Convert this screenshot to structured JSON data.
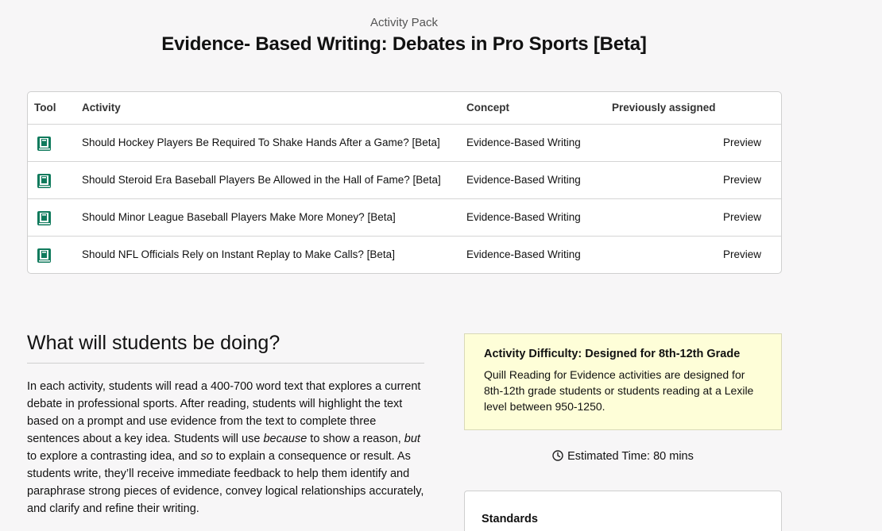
{
  "header": {
    "subtitle": "Activity Pack",
    "title": "Evidence- Based Writing: Debates in Pro Sports [Beta]"
  },
  "table": {
    "columns": {
      "tool": "Tool",
      "activity": "Activity",
      "concept": "Concept",
      "previously_assigned": "Previously assigned"
    },
    "rows": [
      {
        "tool_icon": "book-icon",
        "activity": "Should Hockey Players Be Required To Shake Hands After a Game? [Beta]",
        "concept": "Evidence-Based Writing",
        "preview": "Preview"
      },
      {
        "tool_icon": "book-icon",
        "activity": "Should Steroid Era Baseball Players Be Allowed in the Hall of Fame? [Beta]",
        "concept": "Evidence-Based Writing",
        "preview": "Preview"
      },
      {
        "tool_icon": "book-icon",
        "activity": "Should Minor League Baseball Players Make More Money? [Beta]",
        "concept": "Evidence-Based Writing",
        "preview": "Preview"
      },
      {
        "tool_icon": "book-icon",
        "activity": "Should NFL Officials Rely on Instant Replay to Make Calls? [Beta]",
        "concept": "Evidence-Based Writing",
        "preview": "Preview"
      }
    ]
  },
  "details": {
    "heading": "What will students be doing?",
    "desc_part1": "In each activity, students will read a 400-700 word text that explores a current debate in professional sports. After reading, students will highlight the text based on a prompt and use evidence from the text to complete three sentences about a key idea. Students will use ",
    "desc_because": "because",
    "desc_part2": " to show a reason, ",
    "desc_but": "but",
    "desc_part3": " to explore a contrasting idea, and ",
    "desc_so": "so",
    "desc_part4": " to explain a consequence or result. As students write, they’ll receive immediate feedback to help them identify and paraphrase strong pieces of evidence, convey logical relationships accurately, and clarify and refine their writing."
  },
  "difficulty": {
    "title": "Activity Difficulty: Designed for 8th-12th Grade",
    "body": "Quill Reading for Evidence activities are designed for 8th-12th grade students or students reading at a Lexile level between 950-1250."
  },
  "estimated_time": "Estimated Time: 80 mins",
  "standards": {
    "title": "Standards"
  },
  "colors": {
    "accent_icon": "#0f7a5c",
    "difficulty_bg": "#fefed8",
    "page_bg": "#f7f6f7"
  }
}
